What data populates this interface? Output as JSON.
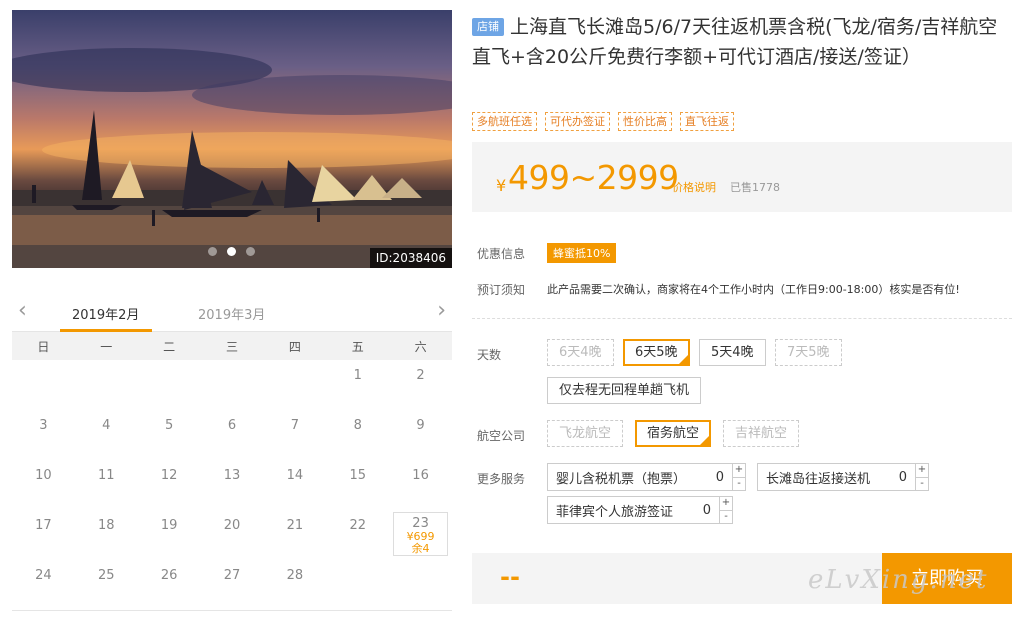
{
  "photo": {
    "id_label": "ID:2038406",
    "slide_count": 3,
    "active_slide": 2
  },
  "calendar": {
    "tabs": [
      "2019年2月",
      "2019年3月"
    ],
    "active_tab": 0,
    "prev_icon": "chevron-left-icon",
    "next_icon": "chevron-right-icon",
    "weekdays": [
      "日",
      "一",
      "二",
      "三",
      "四",
      "五",
      "六"
    ],
    "days": [
      {
        "d": ""
      },
      {
        "d": ""
      },
      {
        "d": ""
      },
      {
        "d": ""
      },
      {
        "d": ""
      },
      {
        "d": "1"
      },
      {
        "d": "2"
      },
      {
        "d": "3"
      },
      {
        "d": "4"
      },
      {
        "d": "5"
      },
      {
        "d": "6"
      },
      {
        "d": "7"
      },
      {
        "d": "8"
      },
      {
        "d": "9"
      },
      {
        "d": "10"
      },
      {
        "d": "11"
      },
      {
        "d": "12"
      },
      {
        "d": "13"
      },
      {
        "d": "14"
      },
      {
        "d": "15"
      },
      {
        "d": "16"
      },
      {
        "d": "17"
      },
      {
        "d": "18"
      },
      {
        "d": "19"
      },
      {
        "d": "20"
      },
      {
        "d": "21"
      },
      {
        "d": "22"
      },
      {
        "d": "23",
        "price": "¥699",
        "stock": "余4"
      },
      {
        "d": "24"
      },
      {
        "d": "25"
      },
      {
        "d": "26"
      },
      {
        "d": "27"
      },
      {
        "d": "28"
      },
      {
        "d": ""
      },
      {
        "d": ""
      }
    ]
  },
  "product": {
    "shop_tag": "店铺",
    "title": "上海直飞长滩岛5/6/7天往返机票含税(飞龙/宿务/吉祥航空直飞+含20公斤免费行李额+可代订酒店/接送/签证）",
    "tags": [
      "多航班任选",
      "可代办签证",
      "性价比高",
      "直飞往返"
    ],
    "price_symbol": "¥",
    "price_range": "499~2999",
    "price_explain": "价格说明",
    "sold": "已售1778"
  },
  "info": {
    "promo_label": "优惠信息",
    "promo_badge": "蜂蜜抵10%",
    "notice_label": "预订须知",
    "notice_text": "此产品需要二次确认，商家将在4个工作小时内（工作日9:00-18:00）核实是否有位!"
  },
  "days_option": {
    "label": "天数",
    "options": [
      {
        "text": "6天4晚",
        "state": "disabled"
      },
      {
        "text": "6天5晚",
        "state": "selected"
      },
      {
        "text": "5天4晚",
        "state": "normal"
      },
      {
        "text": "7天5晚",
        "state": "disabled"
      },
      {
        "text": "仅去程无回程单趟飞机",
        "state": "normal"
      }
    ]
  },
  "airline_option": {
    "label": "航空公司",
    "options": [
      {
        "text": "飞龙航空",
        "state": "disabled"
      },
      {
        "text": "宿务航空",
        "state": "selected"
      },
      {
        "text": "吉祥航空",
        "state": "disabled"
      }
    ]
  },
  "services": {
    "label": "更多服务",
    "items": [
      {
        "name": "婴儿含税机票（抱票）",
        "qty": "0"
      },
      {
        "name": "长滩岛往返接送机",
        "qty": "0"
      },
      {
        "name": "菲律宾个人旅游签证",
        "qty": "0"
      }
    ],
    "plus": "+",
    "minus": "-"
  },
  "buy": {
    "total": "--",
    "button": "立即购买"
  },
  "watermark": "eLvXing.net",
  "colors": {
    "accent": "#f39800",
    "shop_tag": "#6ea5e5"
  }
}
